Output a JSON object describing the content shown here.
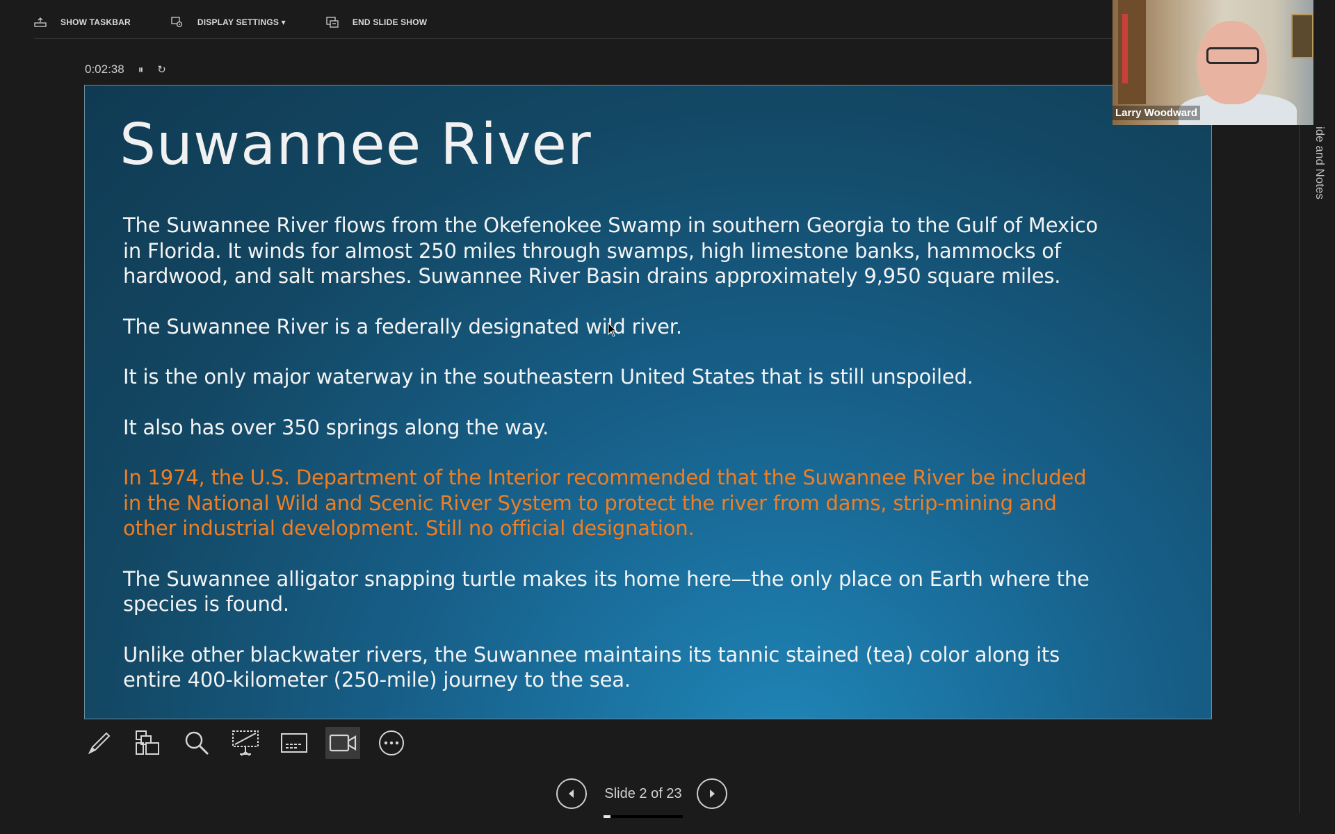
{
  "toolbar": {
    "show_taskbar": "SHOW TASKBAR",
    "display_settings": "DISPLAY SETTINGS ▾",
    "end_slide_show": "END SLIDE SHOW"
  },
  "timer": {
    "elapsed": "0:02:38",
    "pause_glyph": "⏸",
    "restart_glyph": "↻"
  },
  "slide": {
    "title": "Suwannee River",
    "paragraphs": [
      "The Suwannee River flows from the Okefenokee Swamp in southern Georgia to the Gulf of Mexico in Florida. It winds for almost 250 miles through swamps, high limestone banks, hammocks of hardwood, and salt marshes. Suwannee River Basin drains approximately 9,950 square miles.",
      "The Suwannee River is a federally designated wild river.",
      "It is the only major waterway in the southeastern United States that is still unspoiled.",
      "It also has over 350 springs along the way.",
      "In 1974, the U.S. Department of the Interior recommended that the Suwannee River be included in the National Wild and Scenic River System to protect the river from dams, strip-mining and other industrial development.  Still no official designation.",
      "The Suwannee alligator snapping turtle makes its home here—the only place on Earth where the species is found.",
      "Unlike other blackwater rivers, the Suwannee maintains its tannic stained (tea) color along its entire 400-kilometer (250-mile) journey to the sea."
    ],
    "highlight_color": "#f07e22"
  },
  "presenter": {
    "name": "Larry Woodward"
  },
  "notes_panel": {
    "label": "ide and Notes"
  },
  "navigation": {
    "counter": "Slide 2 of 23",
    "progress_fraction": 0.087
  }
}
